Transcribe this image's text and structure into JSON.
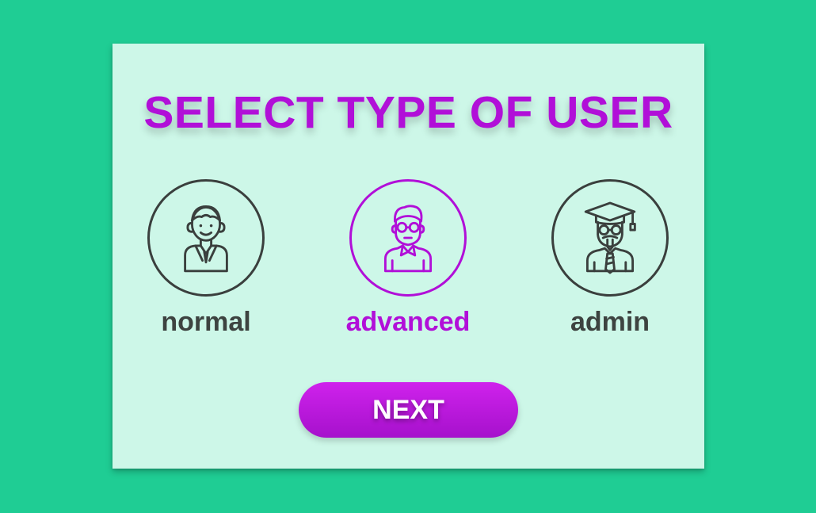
{
  "title": "SELECT TYPE OF USER",
  "options": [
    {
      "label": "normal",
      "icon": "young-man-avatar-icon",
      "selected": false
    },
    {
      "label": "advanced",
      "icon": "glasses-man-avatar-icon",
      "selected": true
    },
    {
      "label": "admin",
      "icon": "graduate-professor-avatar-icon",
      "selected": false
    }
  ],
  "next_label": "NEXT",
  "colors": {
    "background": "#1fcd94",
    "card": "#cdf7e8",
    "accent": "#b10fd8",
    "text_dark": "#3d4340"
  }
}
